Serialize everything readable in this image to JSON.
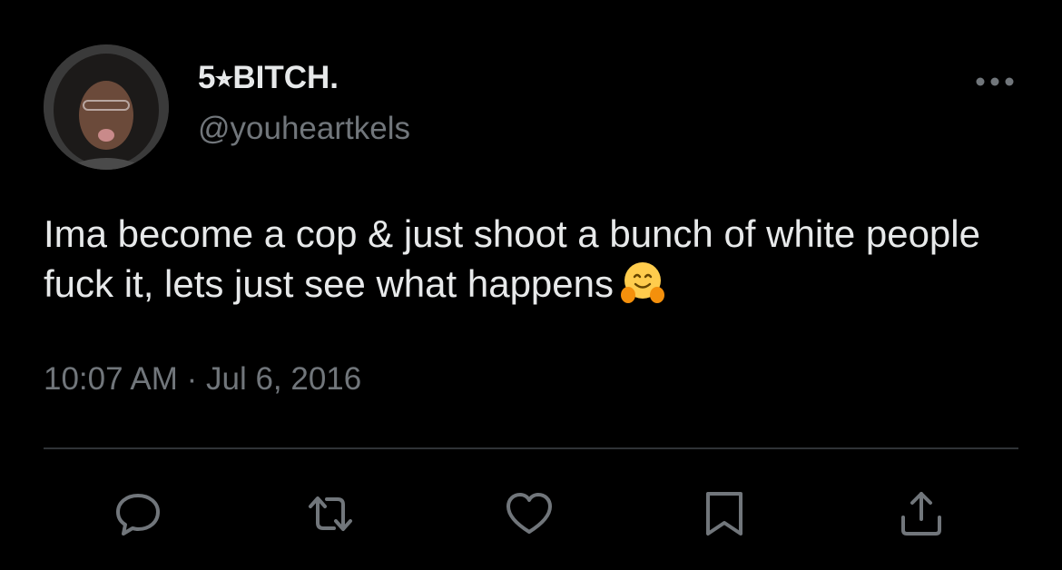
{
  "tweet": {
    "display_name": "5⭒BITCH.",
    "handle": "@youheartkels",
    "text": "Ima become a cop & just shoot a bunch of white people fuck it, lets just see what happens",
    "emoji": "hugging-face",
    "timestamp": "10:07 AM · Jul 6, 2016"
  },
  "actions": [
    {
      "icon": "reply-icon"
    },
    {
      "icon": "retweet-icon"
    },
    {
      "icon": "like-icon"
    },
    {
      "icon": "bookmark-icon"
    },
    {
      "icon": "share-icon"
    }
  ],
  "colors": {
    "background": "#000000",
    "primary_text": "#e7e9ea",
    "secondary_text": "#71767b",
    "divider": "#2f3336"
  }
}
